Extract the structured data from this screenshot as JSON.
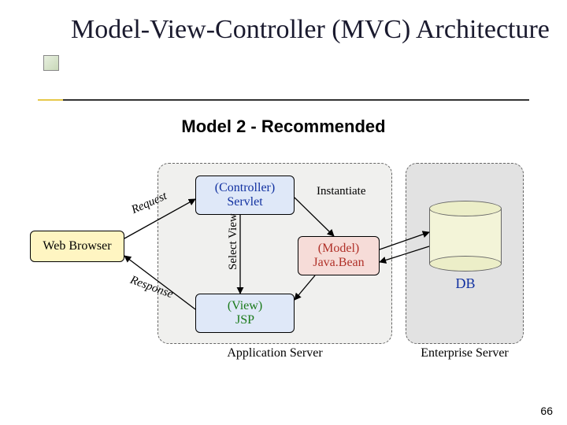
{
  "title": "Model-View-Controller (MVC) Architecture",
  "subtitle": "Model 2 - Recommended",
  "page_number": "66",
  "containers": {
    "app_server": "Application Server",
    "ent_server": "Enterprise Server"
  },
  "nodes": {
    "browser": "Web Browser",
    "controller_l1": "(Controller)",
    "controller_l2": "Servlet",
    "model_l1": "(Model)",
    "model_l2": "Java.Bean",
    "view_l1": "(View)",
    "view_l2": "JSP",
    "db": "DB"
  },
  "edges": {
    "request": "Request",
    "response": "Response",
    "select_view": "Select View",
    "instantiate": "Instantiate"
  }
}
